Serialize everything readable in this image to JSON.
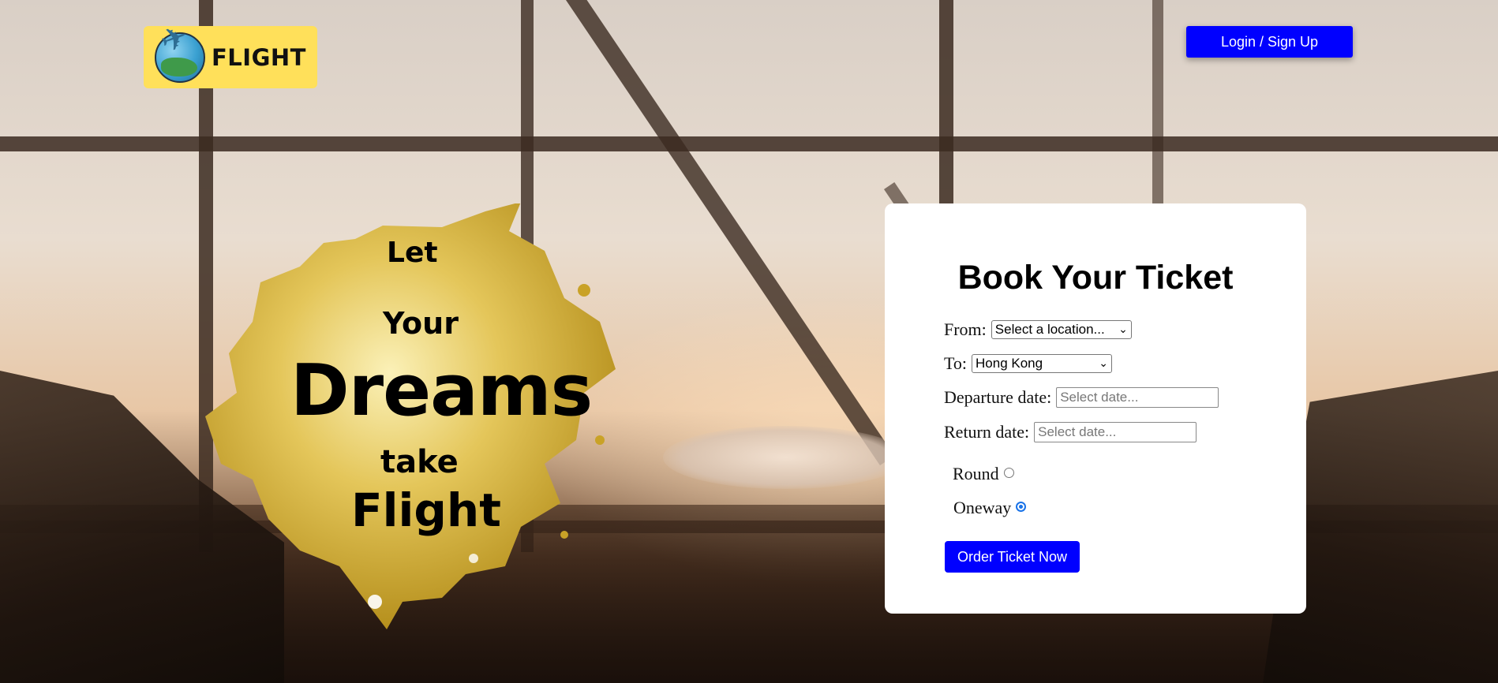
{
  "header": {
    "logo_text": "FLIGHT",
    "login_label": "Login / Sign Up"
  },
  "hero": {
    "line1": "Let",
    "line2": "Your",
    "line3": "Dreams",
    "line4": "take",
    "line5": "Flight"
  },
  "booking": {
    "title": "Book Your Ticket",
    "from_label": "From:",
    "from_value": "Select a location...",
    "to_label": "To:",
    "to_value": "Hong Kong",
    "departure_label": "Departure date:",
    "departure_placeholder": "Select date...",
    "return_label": "Return date:",
    "return_placeholder": "Select date...",
    "trip_types": [
      {
        "label": "Round",
        "checked": false
      },
      {
        "label": "Oneway",
        "checked": true
      }
    ],
    "order_label": "Order Ticket Now"
  },
  "colors": {
    "accent": "#0000ff",
    "logo_bg": "#ffe05a",
    "splash_gold": "#c9a227"
  },
  "icons": {
    "logo": "globe-plane-icon",
    "dropdown": "chevron-down-icon"
  }
}
